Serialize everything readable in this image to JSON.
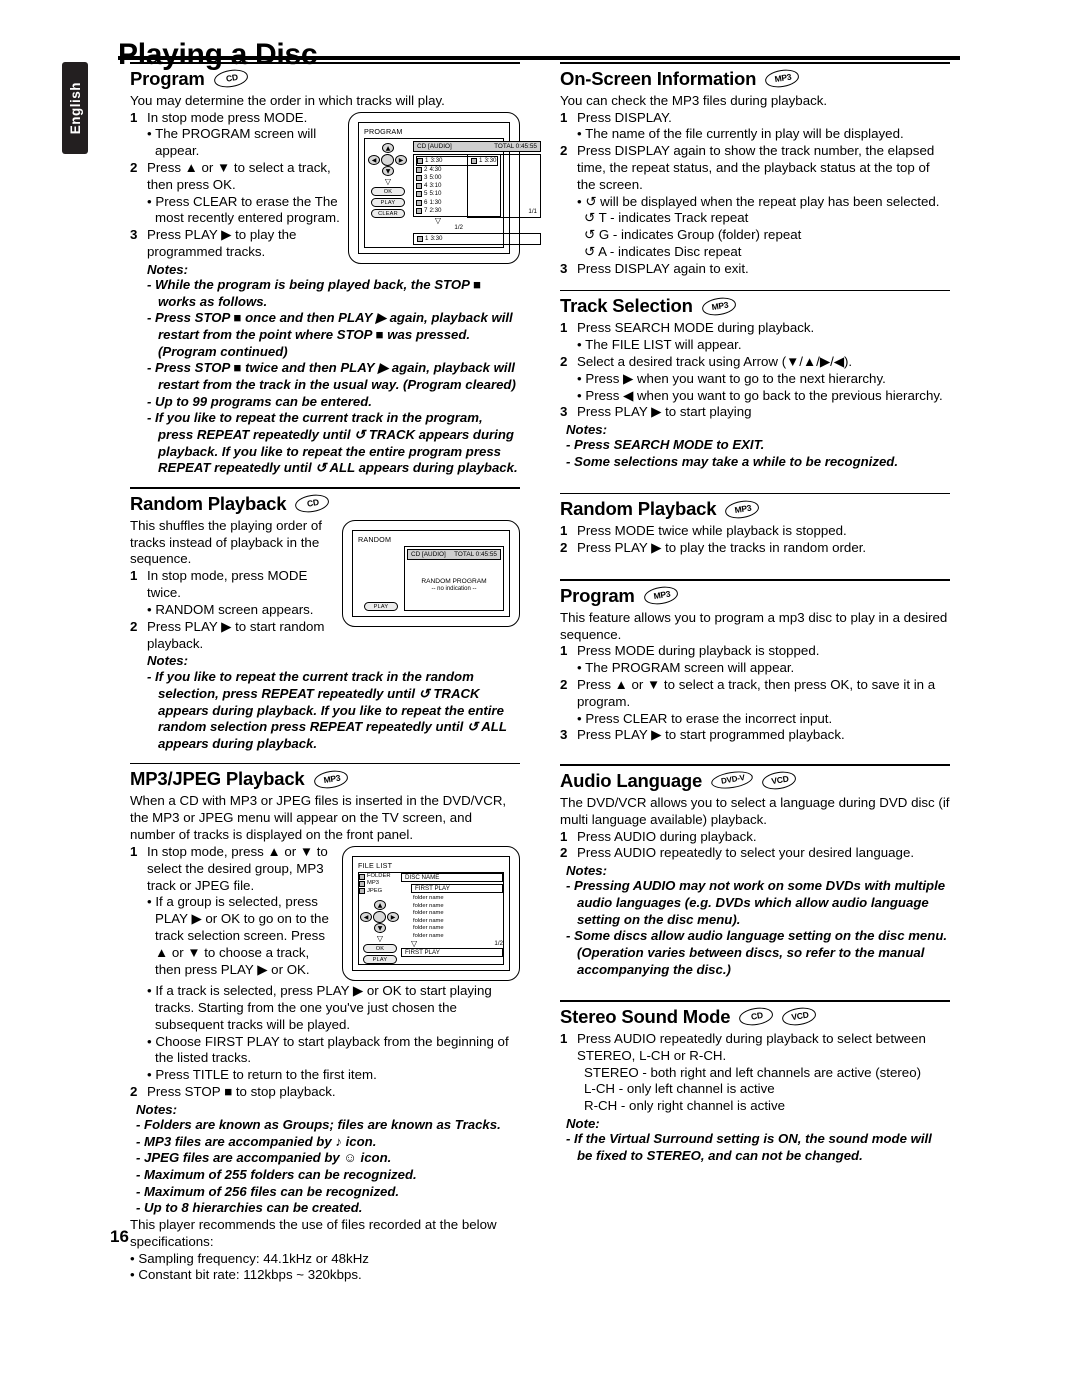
{
  "page": {
    "title": "Playing a Disc",
    "language_tab": "English",
    "number": "16"
  },
  "badges": {
    "cd": "CD",
    "mp3": "MP3",
    "dvdv": "DVD-V",
    "vcd": "VCD"
  },
  "left_column": {
    "program_cd": {
      "heading": "Program",
      "badge": "CD",
      "intro": "You may determine the order in which tracks will play.",
      "steps": [
        {
          "n": "1",
          "text": "In stop mode press MODE.",
          "bullets": [
            "• The PROGRAM screen will appear."
          ]
        },
        {
          "n": "2",
          "text": "Press ▲ or ▼ to select a track, then press OK.",
          "bullets": [
            "• Press CLEAR to erase the The most recently entered program."
          ]
        },
        {
          "n": "3",
          "text": "Press PLAY ▶ to play the programmed tracks.",
          "bullets": []
        }
      ],
      "notes_label": "Notes:",
      "notes": [
        "- While the program is being played back, the STOP ■ works as follows.",
        "- Press STOP ■ once and then PLAY ▶ again, playback will restart from the point where STOP ■ was pressed. (Program continued)",
        "- Press STOP ■ twice and then PLAY ▶ again, playback will restart from the track in the usual way. (Program cleared)",
        "- Up to 99 programs can be entered.",
        "- If you like to repeat the current track in the program, press REPEAT repeatedly until ↺ TRACK appears during playback. If you like to repeat the entire program press REPEAT repeatedly until ↺ ALL appears during playback."
      ],
      "diagram": {
        "screen_label": "PROGRAM",
        "header_left": "CD [AUDIO]",
        "header_right": "TOTAL   0:45:55",
        "tracks": [
          {
            "n": "1",
            "time": "3:30"
          },
          {
            "n": "2",
            "time": "4:30"
          },
          {
            "n": "3",
            "time": "5:00"
          },
          {
            "n": "4",
            "time": "3:10"
          },
          {
            "n": "5",
            "time": "5:10"
          },
          {
            "n": "6",
            "time": "1:30"
          },
          {
            "n": "7",
            "time": "2:30"
          }
        ],
        "list_page": "1/2",
        "program_entry": {
          "n": "1",
          "time": "3:30"
        },
        "program_page": "1/1",
        "bottom_entry": {
          "n": "1",
          "time": "3:30"
        },
        "buttons": [
          "OK",
          "PLAY",
          "CLEAR"
        ]
      }
    },
    "random_cd": {
      "heading": "Random Playback",
      "badge": "CD",
      "intro": "This shuffles the playing order of tracks instead of playback in the sequence.",
      "steps": [
        {
          "n": "1",
          "text": "In stop mode, press MODE twice.",
          "bullets": [
            "• RANDOM screen appears."
          ]
        },
        {
          "n": "2",
          "text": "Press PLAY ▶ to start random playback.",
          "bullets": []
        }
      ],
      "notes_label": "Notes:",
      "notes": [
        "- If you like to repeat the current track in the random selection, press REPEAT repeatedly until ↺ TRACK appears during playback. If you like to repeat the entire random selection press REPEAT repeatedly until ↺ ALL appears during playback."
      ],
      "diagram": {
        "screen_label": "RANDOM",
        "header_left": "CD [AUDIO]",
        "header_right": "TOTAL  0:45:55",
        "center_line1": "RANDOM PROGRAM",
        "center_line2": "-- no indication --",
        "buttons": [
          "PLAY"
        ]
      }
    },
    "mp3jpeg": {
      "heading": "MP3/JPEG Playback",
      "badge": "MP3",
      "intro": "When a CD with MP3 or JPEG files is inserted in the DVD/VCR, the MP3 or JPEG menu will appear on the TV screen, and number of tracks is displayed on the front panel.",
      "steps": [
        {
          "n": "1",
          "text": "In stop mode, press ▲ or ▼ to select the desired group, MP3 track or JPEG file.",
          "bullets": [
            "• If a group is selected, press PLAY ▶ or OK to go on to the track selection screen. Press ▲ or ▼ to choose a track, then press PLAY ▶ or OK.",
            "• If a track is selected, press PLAY ▶ or OK to start playing tracks. Starting from the one you've just chosen the subsequent tracks will be played.",
            "• Choose FIRST PLAY to start playback from the beginning of the listed tracks.",
            "• Press TITLE to return to the first item."
          ]
        },
        {
          "n": "2",
          "text": "Press STOP ■ to stop playback.",
          "bullets": []
        }
      ],
      "notes_label": "Notes:",
      "notes": [
        "- Folders are known as Groups; files are known as Tracks.",
        "- MP3 files are accompanied by ♪ icon.",
        "- JPEG files are accompanied by ☺ icon.",
        "- Maximum of 255 folders can be recognized.",
        "- Maximum of 256 files can be recognized.",
        "- Up to 8 hierarchies can be created."
      ],
      "closing": "This player recommends the use of files recorded at the below specifications:",
      "specs": [
        "• Sampling frequency: 44.1kHz or 48kHz",
        "• Constant bit rate: 112kbps ~ 320kbps."
      ],
      "diagram": {
        "screen_label": "FILE LIST",
        "types": [
          "FOLDER",
          "MP3",
          "JPEG"
        ],
        "disc_name": "DISC NAME",
        "first_play_top": "FIRST PLAY",
        "rows": [
          "folder name",
          "folder name",
          "folder name",
          "folder name",
          "folder name",
          "folder name"
        ],
        "page": "1/2",
        "first_play_bottom": "FIRST PLAY",
        "buttons": [
          "OK",
          "PLAY"
        ]
      }
    }
  },
  "right_column": {
    "on_screen_info": {
      "heading": "On-Screen Information",
      "badge": "MP3",
      "intro": "You can check the MP3 files during playback.",
      "steps": [
        {
          "n": "1",
          "text": "Press DISPLAY.",
          "bullets": [
            "• The name of the file currently in play will be displayed."
          ]
        },
        {
          "n": "2",
          "text": "Press DISPLAY again to show the track number, the elapsed time, the repeat status, and the playback status at the top of the screen.",
          "bullets": [
            "• ↺ will be displayed when the repeat play has been selected.",
            "↺ T - indicates Track repeat",
            "↺ G - indicates Group (folder) repeat",
            "↺ A - indicates Disc repeat"
          ]
        },
        {
          "n": "3",
          "text": "Press DISPLAY again to exit.",
          "bullets": []
        }
      ]
    },
    "track_selection": {
      "heading": "Track Selection",
      "badge": "MP3",
      "steps": [
        {
          "n": "1",
          "text": "Press SEARCH MODE during playback.",
          "bullets": [
            "• The FILE LIST will appear."
          ]
        },
        {
          "n": "2",
          "text": "Select a desired track using Arrow (▼/▲/▶/◀).",
          "bullets": [
            "• Press ▶ when you want to go to the next hierarchy.",
            "• Press ◀ when you want to go back to the previous hierarchy."
          ]
        },
        {
          "n": "3",
          "text": "Press PLAY ▶ to start playing",
          "bullets": []
        }
      ],
      "notes_label": "Notes:",
      "notes": [
        "- Press SEARCH MODE to EXIT.",
        "- Some selections may take a while to be recognized."
      ]
    },
    "random_mp3": {
      "heading": "Random Playback",
      "badge": "MP3",
      "steps": [
        {
          "n": "1",
          "text": "Press MODE twice while playback is stopped.",
          "bullets": []
        },
        {
          "n": "2",
          "text": "Press PLAY ▶ to play the tracks in random order.",
          "bullets": []
        }
      ]
    },
    "program_mp3": {
      "heading": "Program",
      "badge": "MP3",
      "intro": "This feature allows you to program a mp3 disc to play in a desired sequence.",
      "steps": [
        {
          "n": "1",
          "text": "Press MODE during playback is stopped.",
          "bullets": [
            "• The PROGRAM screen will appear."
          ]
        },
        {
          "n": "2",
          "text": "Press ▲ or ▼ to select a track, then press OK, to save it in a program.",
          "bullets": [
            "• Press CLEAR to erase the incorrect input."
          ]
        },
        {
          "n": "3",
          "text": "Press PLAY ▶ to start programmed playback.",
          "bullets": []
        }
      ]
    },
    "audio_language": {
      "heading": "Audio Language",
      "badges": [
        "DVD-V",
        "VCD"
      ],
      "intro": "The DVD/VCR allows you to select a language during DVD disc (if multi language available) playback.",
      "steps": [
        {
          "n": "1",
          "text": "Press AUDIO during playback.",
          "bullets": []
        },
        {
          "n": "2",
          "text": "Press AUDIO repeatedly to select your desired language.",
          "bullets": []
        }
      ],
      "notes_label": "Notes:",
      "notes": [
        "- Pressing AUDIO may not work on some DVDs with multiple audio languages (e.g. DVDs which allow audio language setting on the disc menu).",
        "- Some discs allow audio language setting on the disc menu. (Operation varies between discs, so refer to the manual accompanying the disc.)"
      ]
    },
    "stereo_sound_mode": {
      "heading": "Stereo Sound Mode",
      "badges": [
        "CD",
        "VCD"
      ],
      "steps": [
        {
          "n": "1",
          "text": "Press AUDIO repeatedly during playback to select between STEREO, L-CH or R-CH.",
          "bullets": []
        }
      ],
      "modes": [
        "STEREO - both right and left channels are active (stereo)",
        "L-CH - only left channel is active",
        "R-CH - only right channel is active"
      ],
      "notes_label": "Note:",
      "notes": [
        "- If the Virtual Surround setting is ON, the sound mode will be fixed to STEREO, and can not be changed."
      ]
    }
  }
}
